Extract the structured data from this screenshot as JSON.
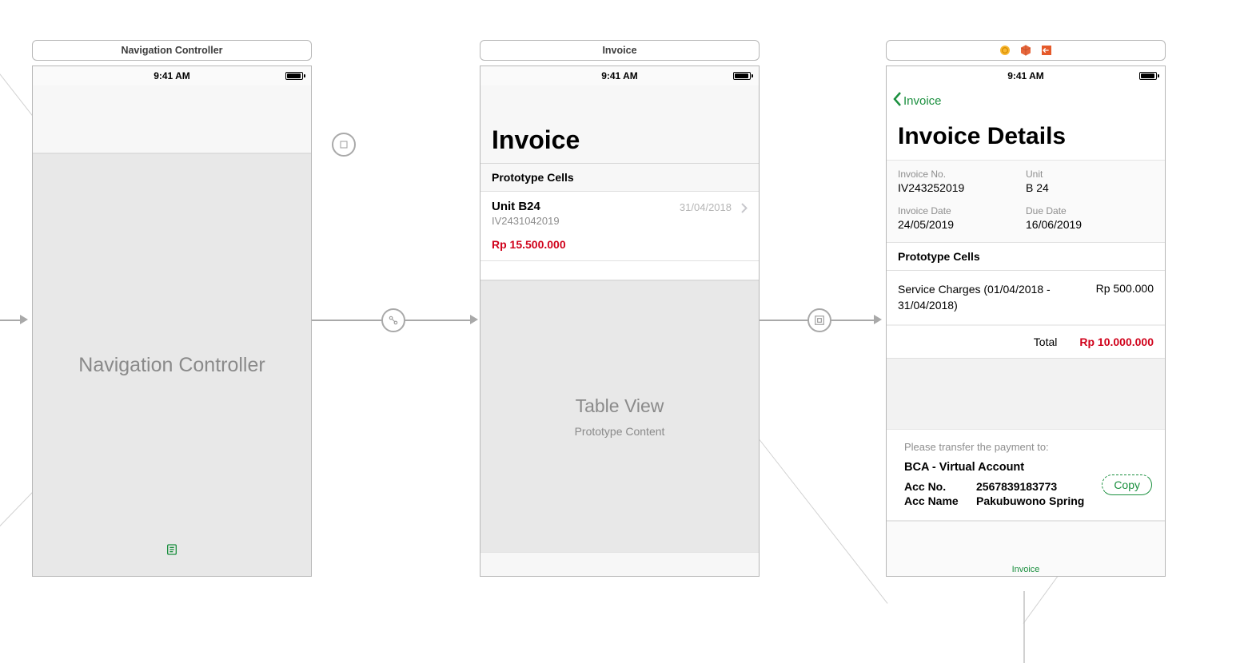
{
  "status_time": "9:41 AM",
  "scene1": {
    "title": "Navigation Controller",
    "body_label": "Navigation Controller"
  },
  "scene2": {
    "title": "Invoice",
    "large_title": "Invoice",
    "section_header": "Prototype Cells",
    "cell": {
      "unit": "Unit B24",
      "code": "IV2431042019",
      "price": "Rp 15.500.000",
      "date": "31/04/2018"
    },
    "placeholder_primary": "Table View",
    "placeholder_secondary": "Prototype Content"
  },
  "scene3": {
    "back_label": "Invoice",
    "title": "Invoice Details",
    "info": {
      "invoice_no_label": "Invoice No.",
      "invoice_no": "IV243252019",
      "unit_label": "Unit",
      "unit": "B 24",
      "invoice_date_label": "Invoice Date",
      "invoice_date": "24/05/2019",
      "due_date_label": "Due Date",
      "due_date": "16/06/2019"
    },
    "section_header": "Prototype Cells",
    "charge": {
      "name": "Service Charges (01/04/2018 - 31/04/2018)",
      "amount": "Rp 500.000"
    },
    "total_label": "Total",
    "total_value": "Rp 10.000.000",
    "payment": {
      "instruction": "Please transfer the payment to:",
      "bank": "BCA - Virtual Account",
      "acc_no_label": "Acc No.",
      "acc_no": "2567839183773",
      "acc_name_label": "Acc Name",
      "acc_name": "Pakubuwono Spring",
      "copy": "Copy"
    },
    "tab_label": "Invoice"
  }
}
